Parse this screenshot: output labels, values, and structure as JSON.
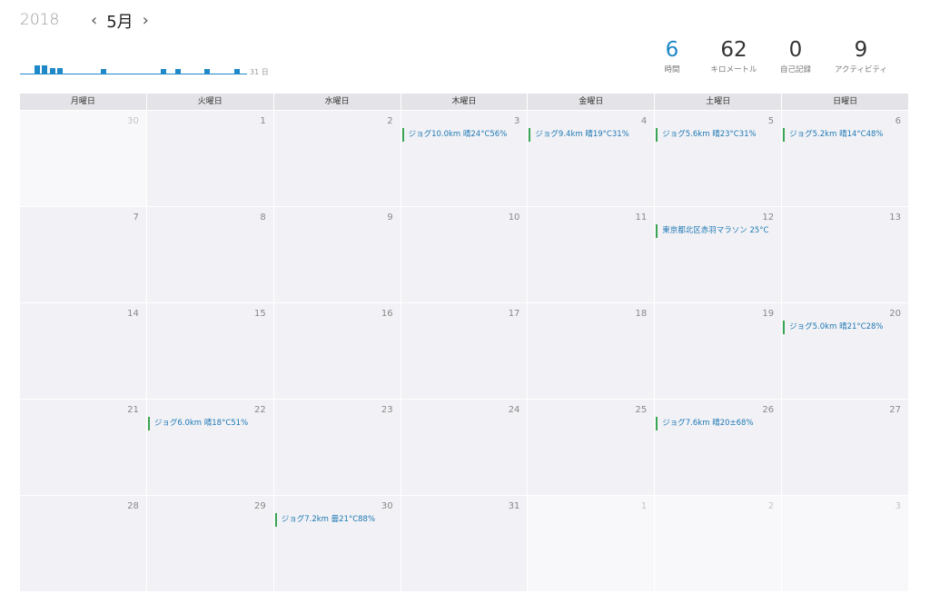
{
  "header": {
    "year": "2018",
    "prev_icon": "chevron-left-icon",
    "prev_glyph": "‹",
    "month": "5月",
    "next_icon": "chevron-right-icon",
    "next_glyph": "›"
  },
  "sparkline": {
    "end_label": "31 日",
    "days_with_activity": [
      3,
      4,
      5,
      6,
      12,
      20,
      22,
      26,
      30
    ],
    "days_in_month": 31
  },
  "stats": [
    {
      "value": "6",
      "label": "時間"
    },
    {
      "value": "62",
      "label": "キロメートル"
    },
    {
      "value": "0",
      "label": "自己記録"
    },
    {
      "value": "9",
      "label": "アクティビティ"
    }
  ],
  "weekdays": [
    "月曜日",
    "火曜日",
    "水曜日",
    "木曜日",
    "金曜日",
    "土曜日",
    "日曜日"
  ],
  "weeks": [
    [
      {
        "day": "30",
        "other": true,
        "event": ""
      },
      {
        "day": "1",
        "other": false,
        "event": ""
      },
      {
        "day": "2",
        "other": false,
        "event": ""
      },
      {
        "day": "3",
        "other": false,
        "event": "ジョグ10.0km 晴24°C56%"
      },
      {
        "day": "4",
        "other": false,
        "event": "ジョグ9.4km 晴19°C31%"
      },
      {
        "day": "5",
        "other": false,
        "event": "ジョグ5.6km 晴23°C31%"
      },
      {
        "day": "6",
        "other": false,
        "event": "ジョグ5.2km 晴14°C48%"
      }
    ],
    [
      {
        "day": "7",
        "other": false,
        "event": ""
      },
      {
        "day": "8",
        "other": false,
        "event": ""
      },
      {
        "day": "9",
        "other": false,
        "event": ""
      },
      {
        "day": "10",
        "other": false,
        "event": ""
      },
      {
        "day": "11",
        "other": false,
        "event": ""
      },
      {
        "day": "12",
        "other": false,
        "event": "東京都北区赤羽マラソン 25°C"
      },
      {
        "day": "13",
        "other": false,
        "event": ""
      }
    ],
    [
      {
        "day": "14",
        "other": false,
        "event": ""
      },
      {
        "day": "15",
        "other": false,
        "event": ""
      },
      {
        "day": "16",
        "other": false,
        "event": ""
      },
      {
        "day": "17",
        "other": false,
        "event": ""
      },
      {
        "day": "18",
        "other": false,
        "event": ""
      },
      {
        "day": "19",
        "other": false,
        "event": ""
      },
      {
        "day": "20",
        "other": false,
        "event": "ジョグ5.0km 晴21°C28%"
      }
    ],
    [
      {
        "day": "21",
        "other": false,
        "event": ""
      },
      {
        "day": "22",
        "other": false,
        "event": "ジョグ6.0km 晴18°C51%"
      },
      {
        "day": "23",
        "other": false,
        "event": ""
      },
      {
        "day": "24",
        "other": false,
        "event": ""
      },
      {
        "day": "25",
        "other": false,
        "event": ""
      },
      {
        "day": "26",
        "other": false,
        "event": "ジョグ7.6km 晴20±68%"
      },
      {
        "day": "27",
        "other": false,
        "event": ""
      }
    ],
    [
      {
        "day": "28",
        "other": false,
        "event": ""
      },
      {
        "day": "29",
        "other": false,
        "event": ""
      },
      {
        "day": "30",
        "other": false,
        "event": "ジョグ7.2km 曇21°C88%"
      },
      {
        "day": "31",
        "other": false,
        "event": ""
      },
      {
        "day": "1",
        "other": true,
        "event": ""
      },
      {
        "day": "2",
        "other": true,
        "event": ""
      },
      {
        "day": "3",
        "other": true,
        "event": ""
      }
    ]
  ],
  "colors": {
    "accent": "#1e88c8",
    "event_marker": "#3aa655",
    "event_text": "#1e78b4"
  }
}
